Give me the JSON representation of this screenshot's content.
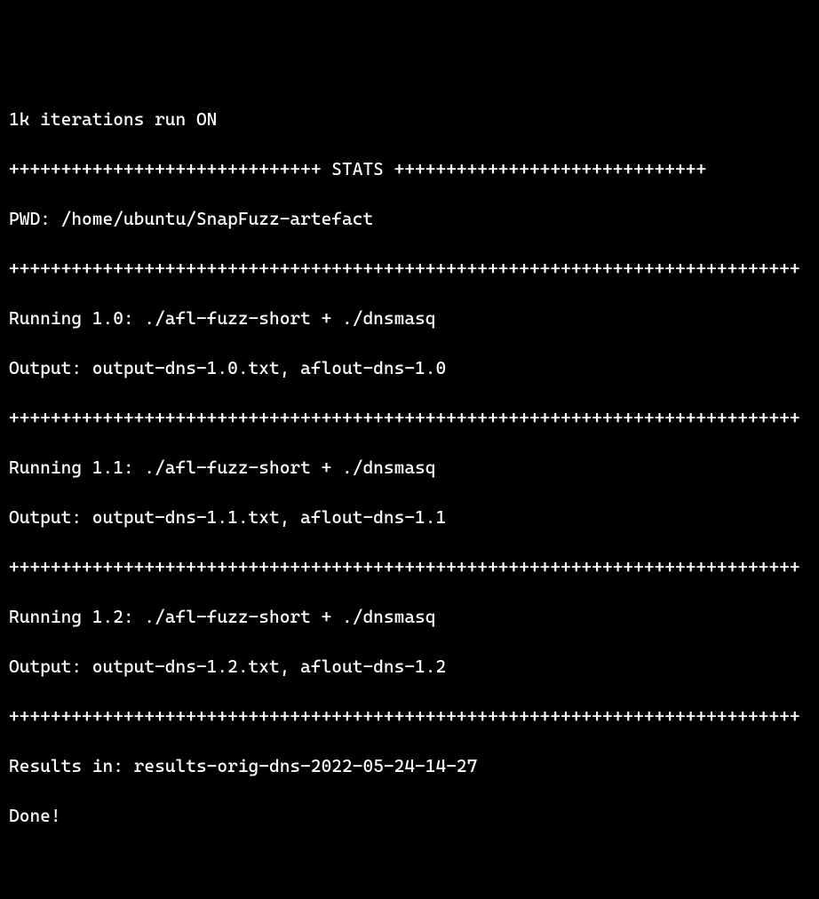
{
  "lines": {
    "l0": "1k iterations run ON",
    "l1": "++++++++++++++++++++++++++++++ STATS ++++++++++++++++++++++++++++++",
    "l2": "PWD: /home/ubuntu/SnapFuzz-artefact",
    "l3": "++++++++++++++++++++++++++++++++++++++++++++++++++++++++++++++++++++++++++++",
    "l4": "Running 1.0: ./afl-fuzz-short + ./dnsmasq",
    "l5": "Output: output-dns-1.0.txt, aflout-dns-1.0",
    "l6": "++++++++++++++++++++++++++++++++++++++++++++++++++++++++++++++++++++++++++++",
    "l7": "Running 1.1: ./afl-fuzz-short + ./dnsmasq",
    "l8": "Output: output-dns-1.1.txt, aflout-dns-1.1",
    "l9": "++++++++++++++++++++++++++++++++++++++++++++++++++++++++++++++++++++++++++++",
    "l10": "Running 1.2: ./afl-fuzz-short + ./dnsmasq",
    "l11": "Output: output-dns-1.2.txt, aflout-dns-1.2",
    "l12": "++++++++++++++++++++++++++++++++++++++++++++++++++++++++++++++++++++++++++++",
    "l13": "Results in: results-orig-dns-2022-05-24-14-27",
    "l14": "Done!"
  }
}
